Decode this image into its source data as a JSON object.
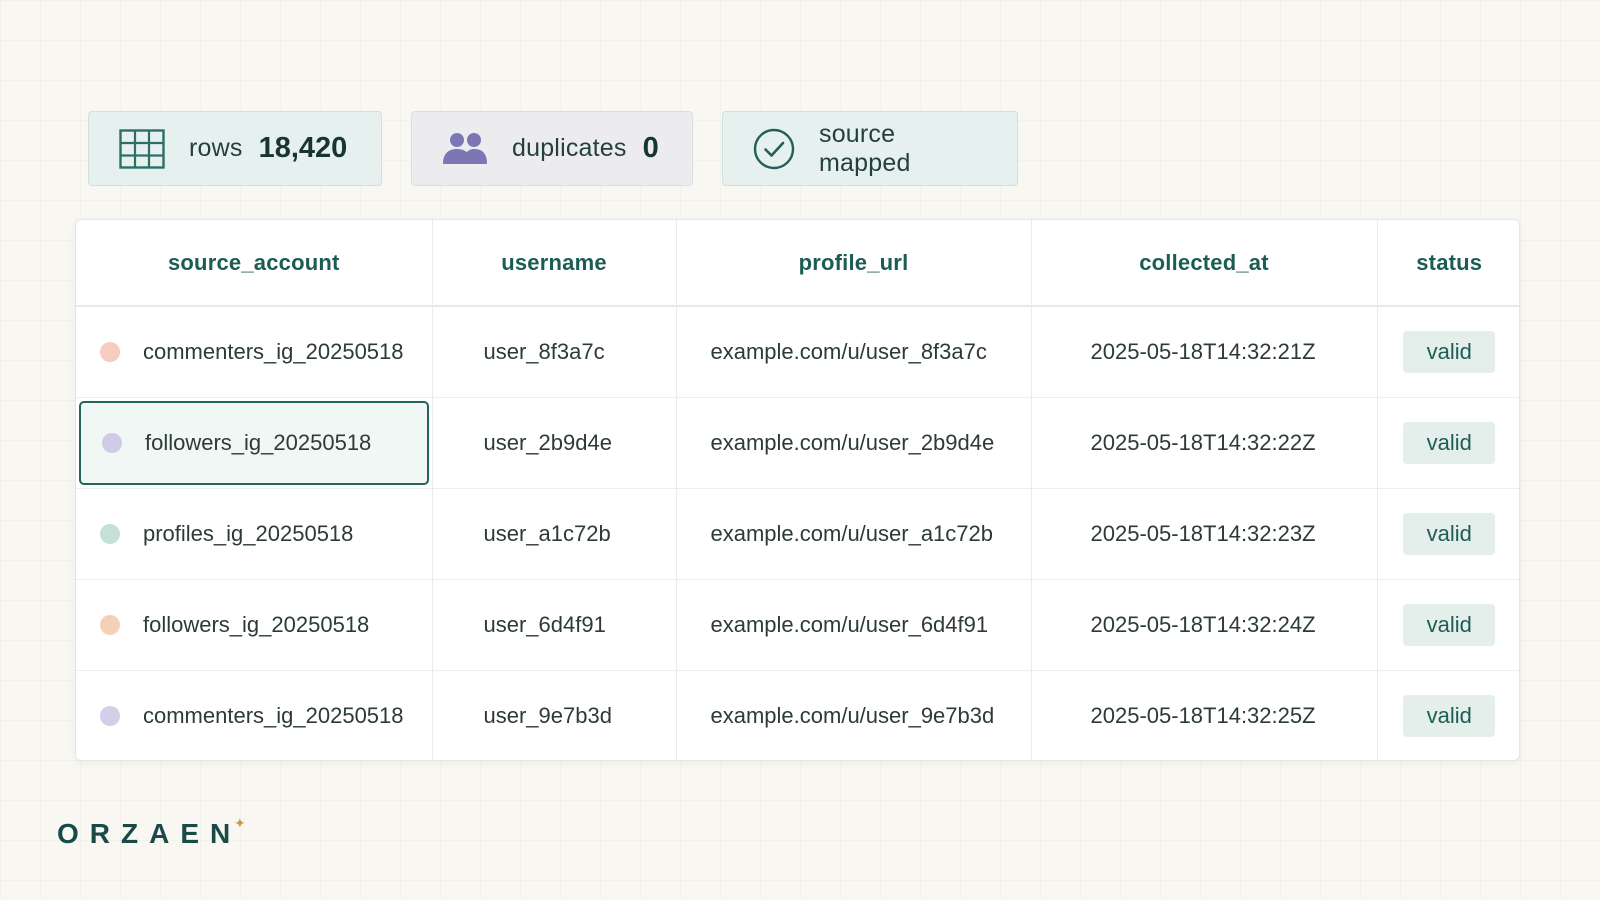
{
  "stats": {
    "rows": {
      "label": "rows",
      "value": "18,420",
      "icon": "table-grid-icon"
    },
    "duplicates": {
      "label": "duplicates",
      "value": "0",
      "icon": "users-icon"
    },
    "mapped": {
      "label": "source mapped",
      "icon": "check-circle-icon"
    }
  },
  "table": {
    "headers": [
      "source_account",
      "username",
      "profile_url",
      "collected_at",
      "status"
    ],
    "rows": [
      {
        "source_account": "commenters_ig_20250518",
        "username": "user_8f3a7c",
        "profile_url": "example.com/u/user_8f3a7c",
        "collected_at": "2025-05-18T14:32:21Z",
        "status": "valid",
        "dot_color": "#f5cdc0"
      },
      {
        "source_account": "followers_ig_20250518",
        "username": "user_2b9d4e",
        "profile_url": "example.com/u/user_2b9d4e",
        "collected_at": "2025-05-18T14:32:22Z",
        "status": "valid",
        "dot_color": "#cfcbe6"
      },
      {
        "source_account": "profiles_ig_20250518",
        "username": "user_a1c72b",
        "profile_url": "example.com/u/user_a1c72b",
        "collected_at": "2025-05-18T14:32:23Z",
        "status": "valid",
        "dot_color": "#c5e1d5"
      },
      {
        "source_account": "followers_ig_20250518",
        "username": "user_6d4f91",
        "profile_url": "example.com/u/user_6d4f91",
        "collected_at": "2025-05-18T14:32:24Z",
        "status": "valid",
        "dot_color": "#f6d0b4"
      },
      {
        "source_account": "commenters_ig_20250518",
        "username": "user_9e7b3d",
        "profile_url": "example.com/u/user_9e7b3d",
        "collected_at": "2025-05-18T14:32:25Z",
        "status": "valid",
        "dot_color": "#d2cfe9"
      }
    ]
  },
  "logo": {
    "text": "ORZAEN",
    "star": "✦"
  },
  "colors": {
    "accent": "#1b5c53",
    "selection_border": "#23655a",
    "badge_bg": "#e4efec",
    "logo": "#1a4a48",
    "logo_star": "#c79b4a"
  }
}
